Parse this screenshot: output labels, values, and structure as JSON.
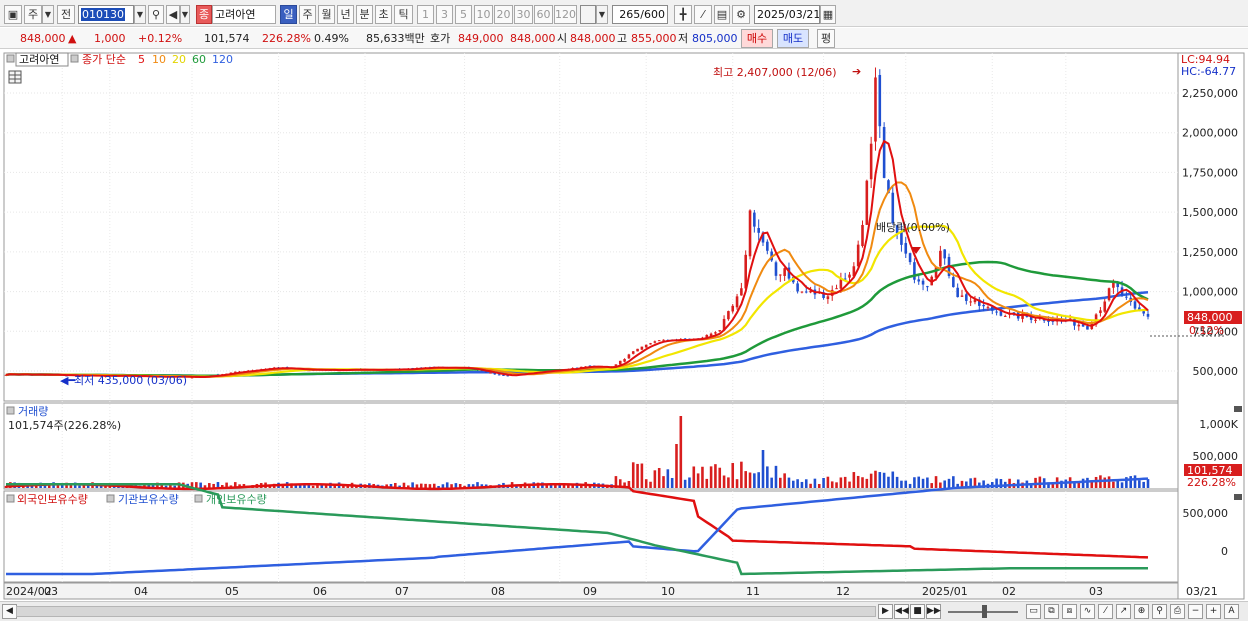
{
  "toolbar": {
    "market_type": "주",
    "prev_label": "전",
    "stock_code": "010130",
    "stock_badge": "종",
    "stock_name": "고려아연",
    "periods": [
      "일",
      "주",
      "월",
      "년",
      "분",
      "초",
      "틱"
    ],
    "active_period": "일",
    "intervals": [
      "1",
      "3",
      "5",
      "10",
      "20",
      "30",
      "60",
      "120"
    ],
    "count_value": "265",
    "count_max": "/600",
    "date": "2025/03/21"
  },
  "info": {
    "price": "848,000",
    "change_arrow": "▲",
    "change": "1,000",
    "change_pct": "+0.12%",
    "volume": "101,574",
    "volume_ratio": "226.28%",
    "turnover": "0.49%",
    "amount": "85,633백만",
    "quote_label": "호가",
    "ask": "849,000",
    "bid": "848,000",
    "open_label": "시",
    "open": "848,000",
    "high_label": "고",
    "high": "855,000",
    "low_label": "저",
    "low": "805,000",
    "buy_label": "매수",
    "sell_label": "매도",
    "eval_label": "평"
  },
  "price_pane": {
    "legend_name": "고려아연",
    "ma_label": "종가 단순",
    "ma_periods": [
      "5",
      "10",
      "20",
      "60",
      "120"
    ],
    "lc_label": "LC:94.94",
    "hc_label": "HC:-64.77",
    "y_ticks": [
      "2,250,000",
      "2,000,000",
      "1,750,000",
      "1,500,000",
      "1,250,000",
      "1,000,000",
      "750,000",
      "500,000"
    ],
    "high_note": "최고 2,407,000 (12/06)",
    "low_note": "최저 435,000 (03/06)",
    "dividend_note": "배당락(0.00%)",
    "last_price_tag": "848,000",
    "last_pct_tag": "0.12%"
  },
  "volume_pane": {
    "title": "거래량",
    "value_text": "101,574주(226.28%)",
    "y_ticks": [
      "1,000K",
      "500,000"
    ],
    "last_tag": "101,574",
    "last_pct_tag": "226.28%"
  },
  "holding_pane": {
    "legend": [
      "외국인보유수량",
      "기관보유수량",
      "개인보유수량"
    ],
    "y_ticks": [
      "500,000",
      "0"
    ]
  },
  "x_axis": {
    "labels": [
      "2024/02",
      "03",
      "04",
      "05",
      "06",
      "07",
      "08",
      "09",
      "10",
      "11",
      "12",
      "2025/01",
      "02",
      "03",
      "03/21"
    ]
  },
  "colors": {
    "up": "#d81e1e",
    "down": "#1f4fd0",
    "ma5": "#e01010",
    "ma10": "#f08a10",
    "ma20": "#f2e600",
    "ma60": "#1f9a3a",
    "ma120": "#2f5fe0",
    "foreign": "#e01010",
    "institution": "#2f5fe0",
    "individual": "#2a9a5a"
  }
}
